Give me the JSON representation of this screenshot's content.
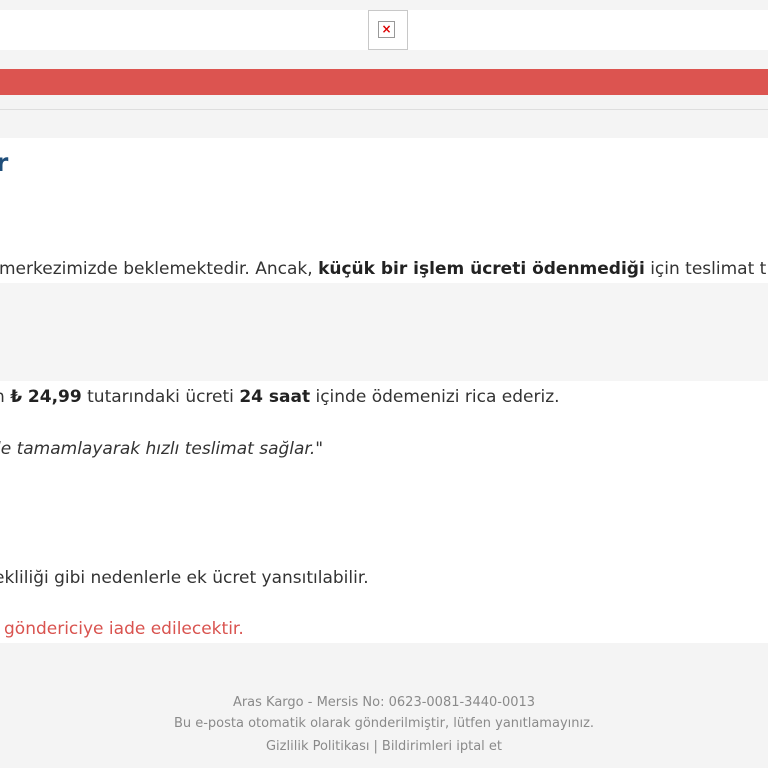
{
  "header": {
    "logo_image": "broken-image-icon"
  },
  "content": {
    "heading": "r",
    "paragraph1": {
      "before": "merkezimizde beklemektedir. Ancak, ",
      "bold": "küçük bir işlem ücreti ödenmediği",
      "after": " için teslimat t"
    },
    "paragraph2": {
      "part1": "n ",
      "amount": "₺ 24,99",
      "part2": " tutarındaki ücreti ",
      "deadline": "24 saat",
      "part3": " içinde ödemenizi rica ederiz."
    },
    "quote": "le tamamlayarak hızlı teslimat sağlar.\"",
    "paragraph3": "ekliliği gibi nedenlerle ek ücret yansıtılabilir.",
    "warning": "göndericiye iade edilecektir."
  },
  "footer": {
    "company": "Aras Kargo - Mersis No: 0623-0081-3440-0013",
    "notice": "Bu e-posta otomatik olarak gönderilmiştir, lütfen yanıtlamayınız.",
    "privacy_link": "Gizlilik Politikası",
    "separator": "|",
    "unsubscribe_link": "Bildirimleri iptal et"
  },
  "colors": {
    "accent_red": "#dc5450",
    "heading_blue": "#1f4e7a",
    "warning_red": "#d9534f"
  }
}
